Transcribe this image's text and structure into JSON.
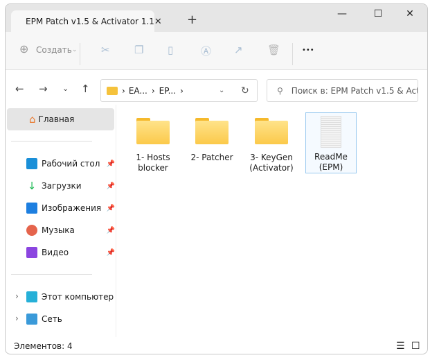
{
  "window": {
    "tab_title": "EPM Patch v1.5 & Activator 1.1",
    "close_tab": "✕",
    "new_tab": "+",
    "minimize": "—",
    "maximize": "☐",
    "close": "✕"
  },
  "toolbar": {
    "create_label": "Создать",
    "more": "•••"
  },
  "address": {
    "segments": [
      "EA...",
      "EP..."
    ],
    "search_placeholder": "Поиск в: EPM Patch v1.5 & Acti..."
  },
  "sidebar": {
    "home": "Главная",
    "pinned": [
      {
        "label": "Рабочий стол",
        "color": "#1a8fd8"
      },
      {
        "label": "Загрузки",
        "color": "#1db954"
      },
      {
        "label": "Изображения",
        "color": "#1d7fe0"
      },
      {
        "label": "Музыка",
        "color": "#e5644c"
      },
      {
        "label": "Видео",
        "color": "#8b45e0"
      }
    ],
    "computer": "Этот компьютер",
    "network": "Сеть"
  },
  "files": [
    {
      "name": "1- Hosts blocker",
      "type": "folder"
    },
    {
      "name": "2- Patcher",
      "type": "folder"
    },
    {
      "name": "3- KeyGen (Activator)",
      "type": "folder"
    },
    {
      "name": "ReadMe (EPM)",
      "type": "text-file",
      "selected": true
    }
  ],
  "status": {
    "count": "Элементов: 4"
  }
}
